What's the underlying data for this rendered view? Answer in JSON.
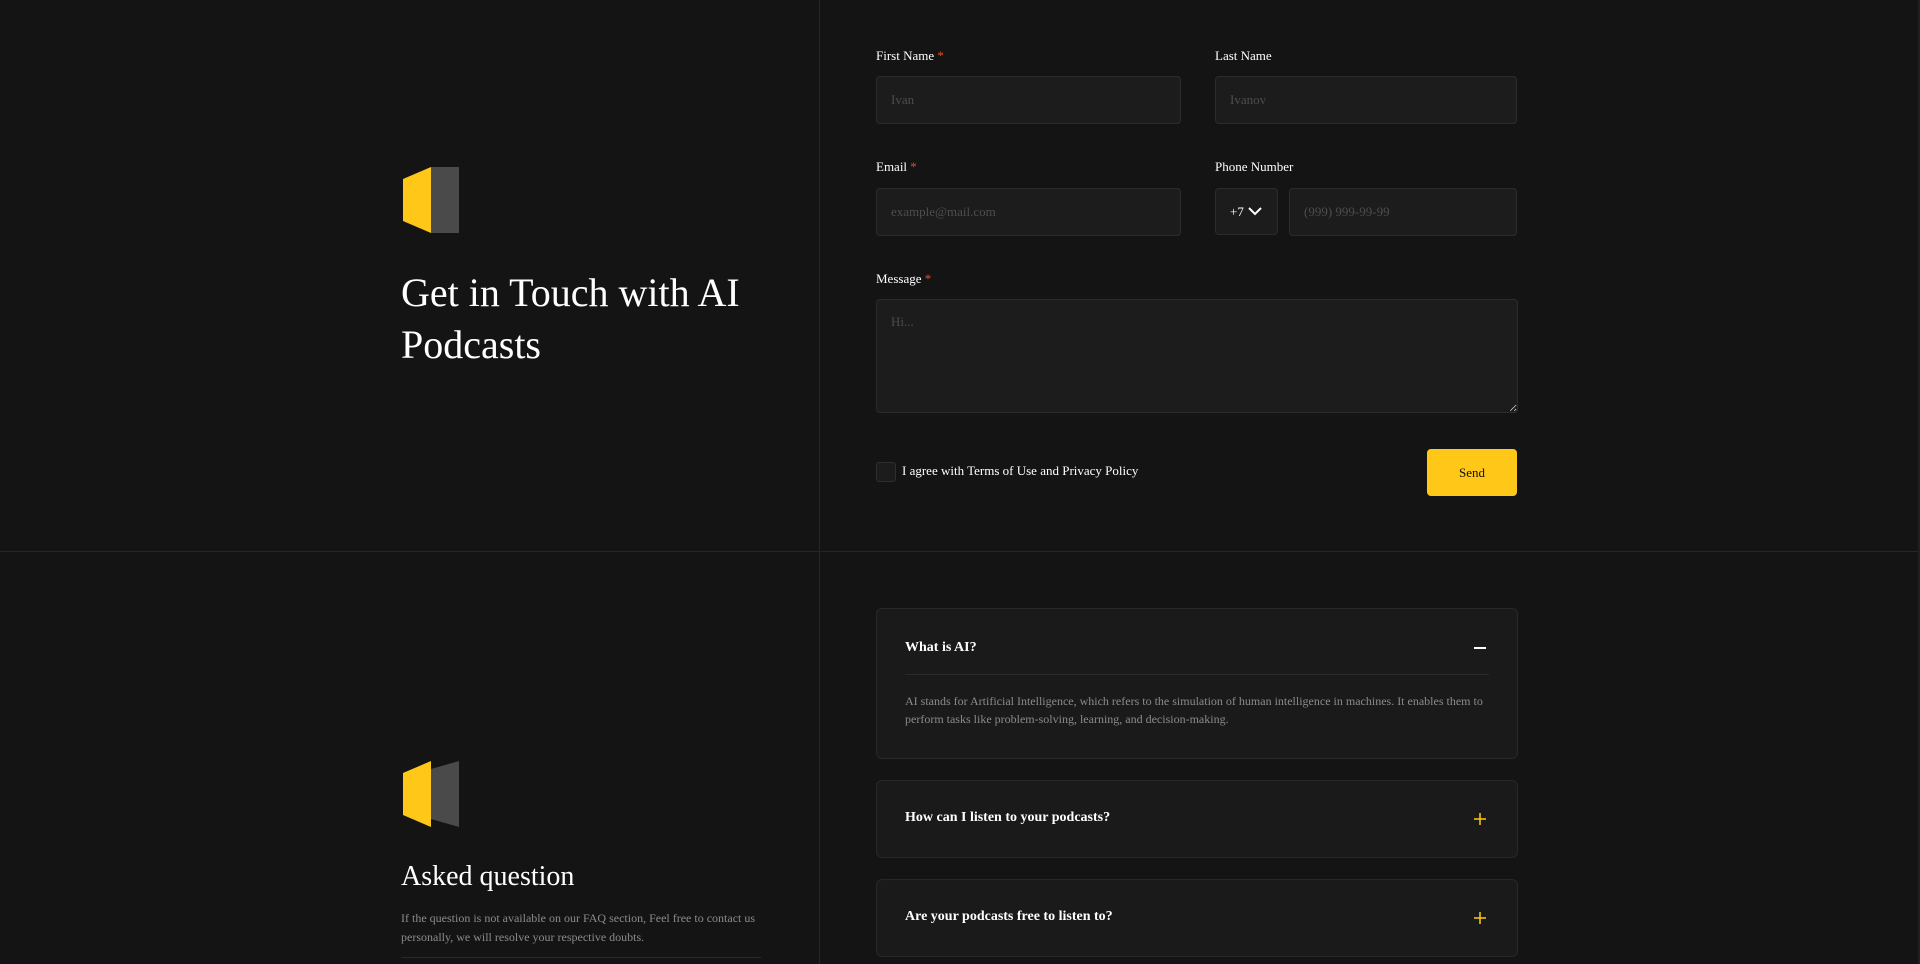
{
  "contact": {
    "title": "Get in Touch with AI Podcasts",
    "form": {
      "first_name_label": "First Name",
      "first_name_placeholder": "Ivan",
      "last_name_label": "Last Name",
      "last_name_placeholder": "Ivanov",
      "email_label": "Email",
      "email_placeholder": "example@mail.com",
      "phone_label": "Phone Number",
      "country_code": "+7",
      "phone_placeholder": "(999) 999-99-99",
      "message_label": "Message",
      "message_placeholder": "Hi...",
      "required_mark": "*",
      "agree_text": "I agree with Terms of Use and Privacy Policy",
      "send_label": "Send"
    }
  },
  "faq": {
    "title": "Asked question",
    "description": "If the question is not available on our FAQ section, Feel free to contact us personally, we will resolve your respective doubts.",
    "items": [
      {
        "question": "What is AI?",
        "answer": "AI stands for Artificial Intelligence, which refers to the simulation of human intelligence in machines. It enables them to perform tasks like problem-solving, learning, and decision-making.",
        "expanded": true
      },
      {
        "question": "How can I listen to your podcasts?",
        "expanded": false
      },
      {
        "question": "Are your podcasts free to listen to?",
        "expanded": false
      }
    ]
  },
  "colors": {
    "background": "#141414",
    "accent": "#ffc818",
    "required": "#e0502b",
    "panel": "#1a1a1a",
    "muted_text": "#8b8b8b"
  },
  "icons": {
    "logo": "logo-icon",
    "collapse": "minus-icon",
    "expand": "plus-icon",
    "dropdown": "chevron-down-icon"
  }
}
